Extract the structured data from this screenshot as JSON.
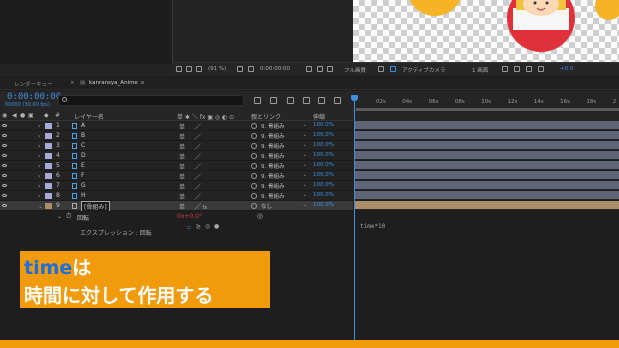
{
  "viewer_toolbar": {
    "zoom": "(91 %)",
    "timecode": "0:00:00:00",
    "resolution": "フル画質",
    "camera": "アクティブカメラ",
    "views": "1 画面",
    "exposure": "+0.0"
  },
  "tabs": {
    "render_queue": "レンダーキュー",
    "comp_tab": "kanransya_Anime"
  },
  "timeline": {
    "timecode": "0:00:00:00",
    "timecode_sub": "00000 (30.00 fps)",
    "search_placeholder": "",
    "ruler_ticks": [
      "02s",
      "04s",
      "06s",
      "08s",
      "10s",
      "12s",
      "14s",
      "16s",
      "18s",
      "2"
    ]
  },
  "columns": {
    "layer_name": "レイヤー名",
    "switches": "单 ✱ ＼ fx ▣ ◎ ◐ ⊙",
    "parent": "親とリンク",
    "stretch": "伸縮"
  },
  "layers": [
    {
      "num": "1",
      "name": "A",
      "parent": "9. 骨組み",
      "stretch": "100.0%"
    },
    {
      "num": "2",
      "name": "B",
      "parent": "9. 骨組み",
      "stretch": "100.0%"
    },
    {
      "num": "3",
      "name": "C",
      "parent": "9. 骨組み",
      "stretch": "100.0%"
    },
    {
      "num": "4",
      "name": "D",
      "parent": "9. 骨組み",
      "stretch": "100.0%"
    },
    {
      "num": "5",
      "name": "E",
      "parent": "9. 骨組み",
      "stretch": "100.0%"
    },
    {
      "num": "6",
      "name": "F",
      "parent": "9. 骨組み",
      "stretch": "100.0%"
    },
    {
      "num": "7",
      "name": "G",
      "parent": "9. 骨組み",
      "stretch": "100.0%"
    },
    {
      "num": "8",
      "name": "H",
      "parent": "9. 骨組み",
      "stretch": "100.0%"
    },
    {
      "num": "9",
      "name": "[骨組み]",
      "parent": "なし",
      "stretch": "100.0%"
    }
  ],
  "property": {
    "name": "回転",
    "value": "0x+0.0°",
    "expression_label": "エクスプレッション : 回転",
    "expression_text": "time*10"
  },
  "caption": {
    "line1_highlight": "time",
    "line1_rest": "は",
    "line2": "時間に対して作用する"
  },
  "colors": {
    "accent_blue": "#3d8fe0",
    "caption_orange": "#f19a0a",
    "layer_label": "#a9a9d9"
  }
}
